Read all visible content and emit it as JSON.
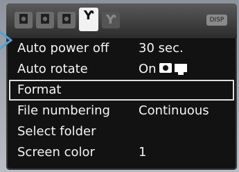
{
  "menu": {
    "tabs": [
      {
        "name": "shooting-tab-1",
        "glyph": "◘"
      },
      {
        "name": "shooting-tab-2",
        "glyph": "◘"
      },
      {
        "name": "shooting-tab-3",
        "glyph": "◘"
      },
      {
        "name": "setup-tab",
        "glyph": "Ƴ"
      },
      {
        "name": "setup-tab-2",
        "glyph": "Ƴ"
      }
    ],
    "badge": "DISP",
    "items": [
      {
        "label": "Auto power off",
        "value": "30 sec."
      },
      {
        "label": "Auto rotate",
        "value": "On"
      },
      {
        "label": "Format",
        "value": ""
      },
      {
        "label": "File numbering",
        "value": "Continuous"
      },
      {
        "label": "Select folder",
        "value": ""
      },
      {
        "label": "Screen color",
        "value": "1"
      }
    ]
  }
}
